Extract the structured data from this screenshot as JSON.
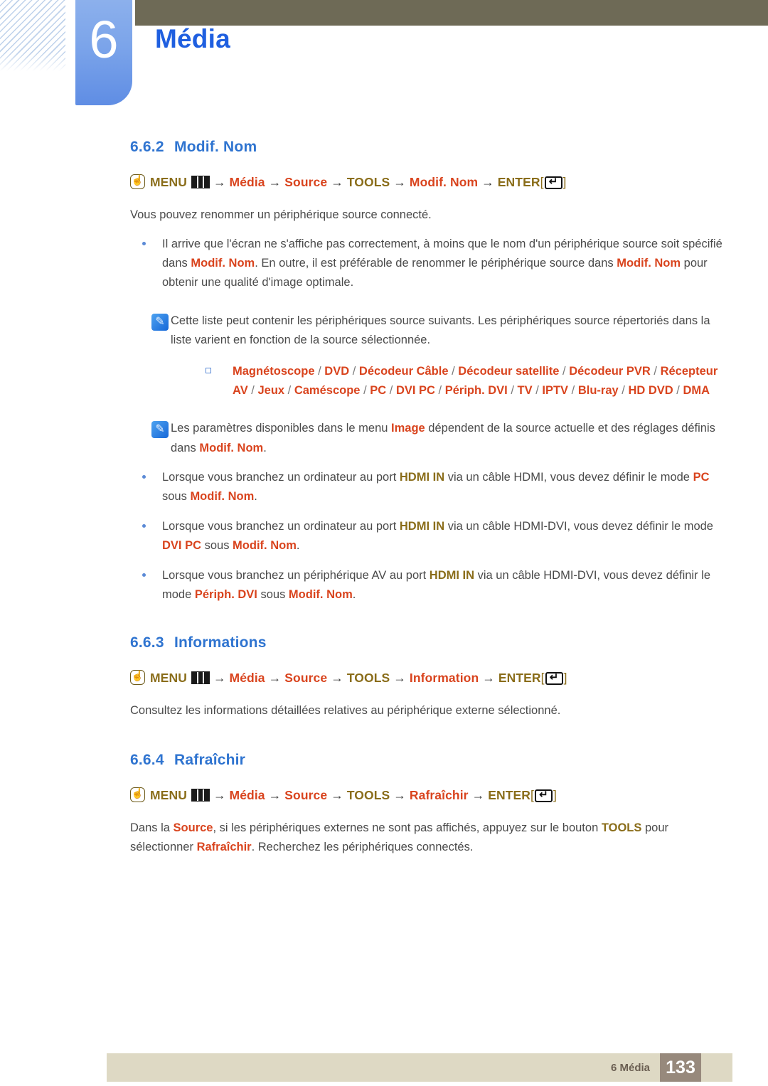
{
  "header": {
    "chapter_number": "6",
    "chapter_title": "Média",
    "accent_blue": "#1f5fe0",
    "bar_color": "#6e6a56"
  },
  "colors": {
    "heading_blue": "#2f74d0",
    "highlight_red": "#d9441e",
    "highlight_gold": "#8a6d1a",
    "body_gray": "#4a4a4a"
  },
  "sections": [
    {
      "number": "6.6.2",
      "title": "Modif. Nom",
      "menu_path": {
        "menu_label": "MENU",
        "steps": [
          "Média",
          "Source",
          "TOOLS",
          "Modif. Nom"
        ],
        "enter_label": "ENTER",
        "bracket_open": "[",
        "bracket_close": "]",
        "arrow": "→"
      },
      "intro": "Vous pouvez renommer un périphérique source connecté.",
      "bullets": [
        {
          "parts": [
            {
              "t": "Il arrive que l'écran ne s'affiche pas correctement, à moins que le nom d'un périphérique source soit spécifié dans ",
              "s": "n"
            },
            {
              "t": "Modif. Nom",
              "s": "r"
            },
            {
              "t": ". En outre, il est préférable de renommer le périphérique source dans ",
              "s": "n"
            },
            {
              "t": "Modif. Nom",
              "s": "r"
            },
            {
              "t": " pour obtenir une qualité d'image optimale.",
              "s": "n"
            }
          ]
        }
      ],
      "note1": {
        "parts": [
          {
            "t": "Cette liste peut contenir les périphériques source suivants. Les périphériques source répertoriés dans la liste varient en fonction de la source sélectionnée.",
            "s": "n"
          }
        ]
      },
      "device_list": {
        "items": [
          "Magnétoscope",
          "DVD",
          "Décodeur Câble",
          "Décodeur satellite",
          "Décodeur PVR",
          "Récepteur AV",
          "Jeux",
          "Caméscope",
          "PC",
          "DVI PC",
          "Périph. DVI",
          "TV",
          "IPTV",
          "Blu-ray",
          "HD DVD",
          "DMA"
        ],
        "separator": "/"
      },
      "note2": {
        "parts": [
          {
            "t": "Les paramètres disponibles dans le menu ",
            "s": "n"
          },
          {
            "t": "Image",
            "s": "r"
          },
          {
            "t": " dépendent de la source actuelle et des réglages définis dans ",
            "s": "n"
          },
          {
            "t": "Modif. Nom",
            "s": "r"
          },
          {
            "t": ".",
            "s": "n"
          }
        ]
      },
      "bullets2": [
        {
          "parts": [
            {
              "t": "Lorsque vous branchez un ordinateur au port ",
              "s": "n"
            },
            {
              "t": "HDMI IN",
              "s": "g"
            },
            {
              "t": " via un câble HDMI, vous devez définir le mode ",
              "s": "n"
            },
            {
              "t": "PC",
              "s": "r"
            },
            {
              "t": " sous ",
              "s": "n"
            },
            {
              "t": "Modif. Nom",
              "s": "r"
            },
            {
              "t": ".",
              "s": "n"
            }
          ]
        },
        {
          "parts": [
            {
              "t": "Lorsque vous branchez un ordinateur au port ",
              "s": "n"
            },
            {
              "t": "HDMI IN",
              "s": "g"
            },
            {
              "t": " via un câble HDMI-DVI, vous devez définir le mode ",
              "s": "n"
            },
            {
              "t": "DVI PC",
              "s": "r"
            },
            {
              "t": " sous ",
              "s": "n"
            },
            {
              "t": "Modif. Nom",
              "s": "r"
            },
            {
              "t": ".",
              "s": "n"
            }
          ]
        },
        {
          "parts": [
            {
              "t": "Lorsque vous branchez un périphérique AV au port ",
              "s": "n"
            },
            {
              "t": "HDMI IN",
              "s": "g"
            },
            {
              "t": " via un câble HDMI-DVI, vous devez définir le mode ",
              "s": "n"
            },
            {
              "t": "Périph. DVI",
              "s": "r"
            },
            {
              "t": " sous ",
              "s": "n"
            },
            {
              "t": "Modif. Nom",
              "s": "r"
            },
            {
              "t": ".",
              "s": "n"
            }
          ]
        }
      ]
    },
    {
      "number": "6.6.3",
      "title": "Informations",
      "menu_path": {
        "menu_label": "MENU",
        "steps": [
          "Média",
          "Source",
          "TOOLS",
          "Information"
        ],
        "enter_label": "ENTER"
      },
      "intro": "Consultez les informations détaillées relatives au périphérique externe sélectionné."
    },
    {
      "number": "6.6.4",
      "title": "Rafraîchir",
      "menu_path": {
        "menu_label": "MENU",
        "steps": [
          "Média",
          "Source",
          "TOOLS",
          "Rafraîchir"
        ],
        "enter_label": "ENTER"
      },
      "body": {
        "parts": [
          {
            "t": "Dans la ",
            "s": "n"
          },
          {
            "t": "Source",
            "s": "r"
          },
          {
            "t": ", si les périphériques externes ne sont pas affichés, appuyez sur le bouton ",
            "s": "n"
          },
          {
            "t": "TOOLS",
            "s": "g"
          },
          {
            "t": " pour sélectionner ",
            "s": "n"
          },
          {
            "t": "Rafraîchir",
            "s": "r"
          },
          {
            "t": ". Recherchez les périphériques connectés.",
            "s": "n"
          }
        ]
      }
    }
  ],
  "footer": {
    "label": "6 Média",
    "page_number": "133",
    "bar_color": "#ded9c4",
    "page_box_color": "#97897c"
  },
  "icons": {
    "hand_press": "hand-press-icon",
    "menu_bars": "menu-bars-icon",
    "enter_key": "enter-key-icon",
    "note_pencil": "note-pencil-icon"
  }
}
